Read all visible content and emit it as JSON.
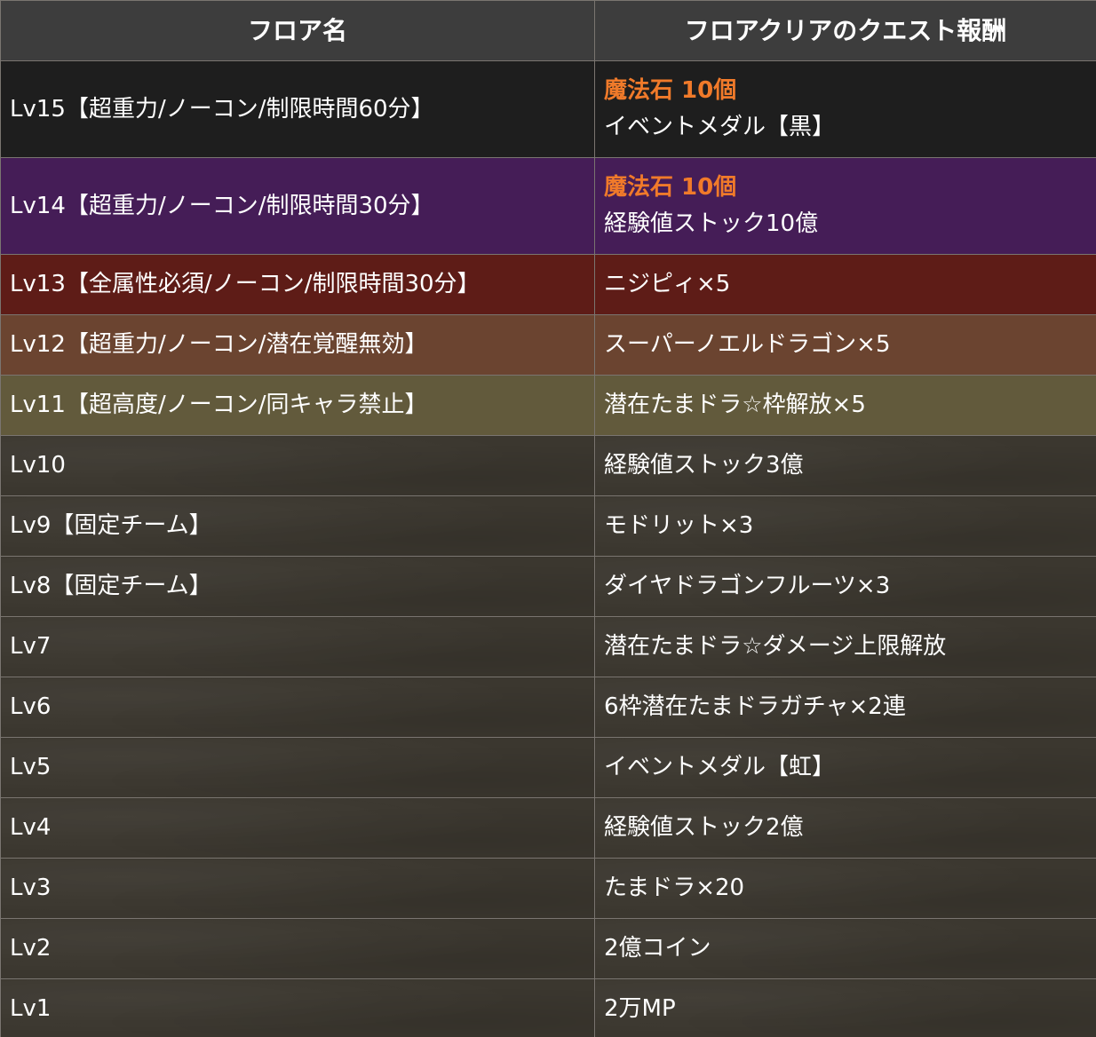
{
  "headers": {
    "floor": "フロア名",
    "reward": "フロアクリアのクエスト報酬"
  },
  "colors": {
    "header_bg": "#3d3d3d",
    "special_text": "#f07a2a",
    "border": "#7a7570"
  },
  "rows": [
    {
      "floor": "Lv15【超重力/ノーコン/制限時間60分】",
      "reward_special": "魔法石 10個",
      "reward": "イベントメダル【黒】",
      "bg": "#1e1e1e"
    },
    {
      "floor": "Lv14【超重力/ノーコン/制限時間30分】",
      "reward_special": "魔法石 10個",
      "reward": "経験値ストック10億",
      "bg": "#451d57"
    },
    {
      "floor": "Lv13【全属性必須/ノーコン/制限時間30分】",
      "reward": "ニジピィ×5",
      "bg": "#5e1c17"
    },
    {
      "floor": "Lv12【超重力/ノーコン/潜在覚醒無効】",
      "reward": "スーパーノエルドラゴン×5",
      "bg": "#6b4430"
    },
    {
      "floor": "Lv11【超高度/ノーコン/同キャラ禁止】",
      "reward": "潜在たまドラ☆枠解放×5",
      "bg": "#625a3c"
    },
    {
      "floor": "Lv10",
      "reward": "経験値ストック3億"
    },
    {
      "floor": "Lv9【固定チーム】",
      "reward": "モドリット×3"
    },
    {
      "floor": "Lv8【固定チーム】",
      "reward": "ダイヤドラゴンフルーツ×3"
    },
    {
      "floor": "Lv7",
      "reward": "潜在たまドラ☆ダメージ上限解放"
    },
    {
      "floor": "Lv6",
      "reward": "6枠潜在たまドラガチャ×2連"
    },
    {
      "floor": "Lv5",
      "reward": "イベントメダル【虹】"
    },
    {
      "floor": "Lv4",
      "reward": "経験値ストック2億"
    },
    {
      "floor": "Lv3",
      "reward": "たまドラ×20"
    },
    {
      "floor": "Lv2",
      "reward": "2億コイン"
    },
    {
      "floor": "Lv1",
      "reward": "2万MP"
    }
  ]
}
